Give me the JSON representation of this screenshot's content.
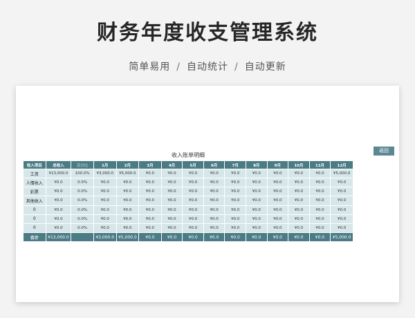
{
  "hero": {
    "title": "财务年度收支管理系统",
    "subtitle_parts": [
      "简单易用",
      "自动统计",
      "自动更新"
    ],
    "separator": "/"
  },
  "sheet": {
    "title": "收入账单明细",
    "back_button": "返回",
    "columns": [
      "收入项目",
      "总收入",
      "百分比",
      "1月",
      "2月",
      "3月",
      "4月",
      "5月",
      "6月",
      "7月",
      "8月",
      "9月",
      "10月",
      "11月",
      "12月"
    ],
    "rows": [
      [
        "工资",
        "¥13,000.0",
        "100.0%",
        "¥3,000.0",
        "¥5,000.0",
        "¥0.0",
        "¥0.0",
        "¥0.0",
        "¥0.0",
        "¥0.0",
        "¥0.0",
        "¥0.0",
        "¥0.0",
        "¥0.0",
        "¥5,000.0"
      ],
      [
        "人情收入",
        "¥0.0",
        "0.0%",
        "¥0.0",
        "¥0.0",
        "¥0.0",
        "¥0.0",
        "¥0.0",
        "¥0.0",
        "¥0.0",
        "¥0.0",
        "¥0.0",
        "¥0.0",
        "¥0.0",
        "¥0.0"
      ],
      [
        "彩票",
        "¥0.0",
        "0.0%",
        "¥0.0",
        "¥0.0",
        "¥0.0",
        "¥0.0",
        "¥0.0",
        "¥0.0",
        "¥0.0",
        "¥0.0",
        "¥0.0",
        "¥0.0",
        "¥0.0",
        "¥0.0"
      ],
      [
        "其他收入",
        "¥0.0",
        "0.0%",
        "¥0.0",
        "¥0.0",
        "¥0.0",
        "¥0.0",
        "¥0.0",
        "¥0.0",
        "¥0.0",
        "¥0.0",
        "¥0.0",
        "¥0.0",
        "¥0.0",
        "¥0.0"
      ],
      [
        "0",
        "¥0.0",
        "0.0%",
        "¥0.0",
        "¥0.0",
        "¥0.0",
        "¥0.0",
        "¥0.0",
        "¥0.0",
        "¥0.0",
        "¥0.0",
        "¥0.0",
        "¥0.0",
        "¥0.0",
        "¥0.0"
      ],
      [
        "0",
        "¥0.0",
        "0.0%",
        "¥0.0",
        "¥0.0",
        "¥0.0",
        "¥0.0",
        "¥0.0",
        "¥0.0",
        "¥0.0",
        "¥0.0",
        "¥0.0",
        "¥0.0",
        "¥0.0",
        "¥0.0"
      ],
      [
        "0",
        "¥0.0",
        "0.0%",
        "¥0.0",
        "¥0.0",
        "¥0.0",
        "¥0.0",
        "¥0.0",
        "¥0.0",
        "¥0.0",
        "¥0.0",
        "¥0.0",
        "¥0.0",
        "¥0.0",
        "¥0.0"
      ]
    ],
    "total": [
      "合计",
      "¥13,000.0",
      "",
      "¥3,000.0",
      "¥5,000.0",
      "¥0.0",
      "¥0.0",
      "¥0.0",
      "¥0.0",
      "¥0.0",
      "¥0.0",
      "¥0.0",
      "¥0.0",
      "¥0.0",
      "¥5,000.0"
    ]
  },
  "colors": {
    "header_bg": "#4b7b85",
    "cell_bg": "#d6e6e9",
    "button_bg": "#5b8894"
  }
}
